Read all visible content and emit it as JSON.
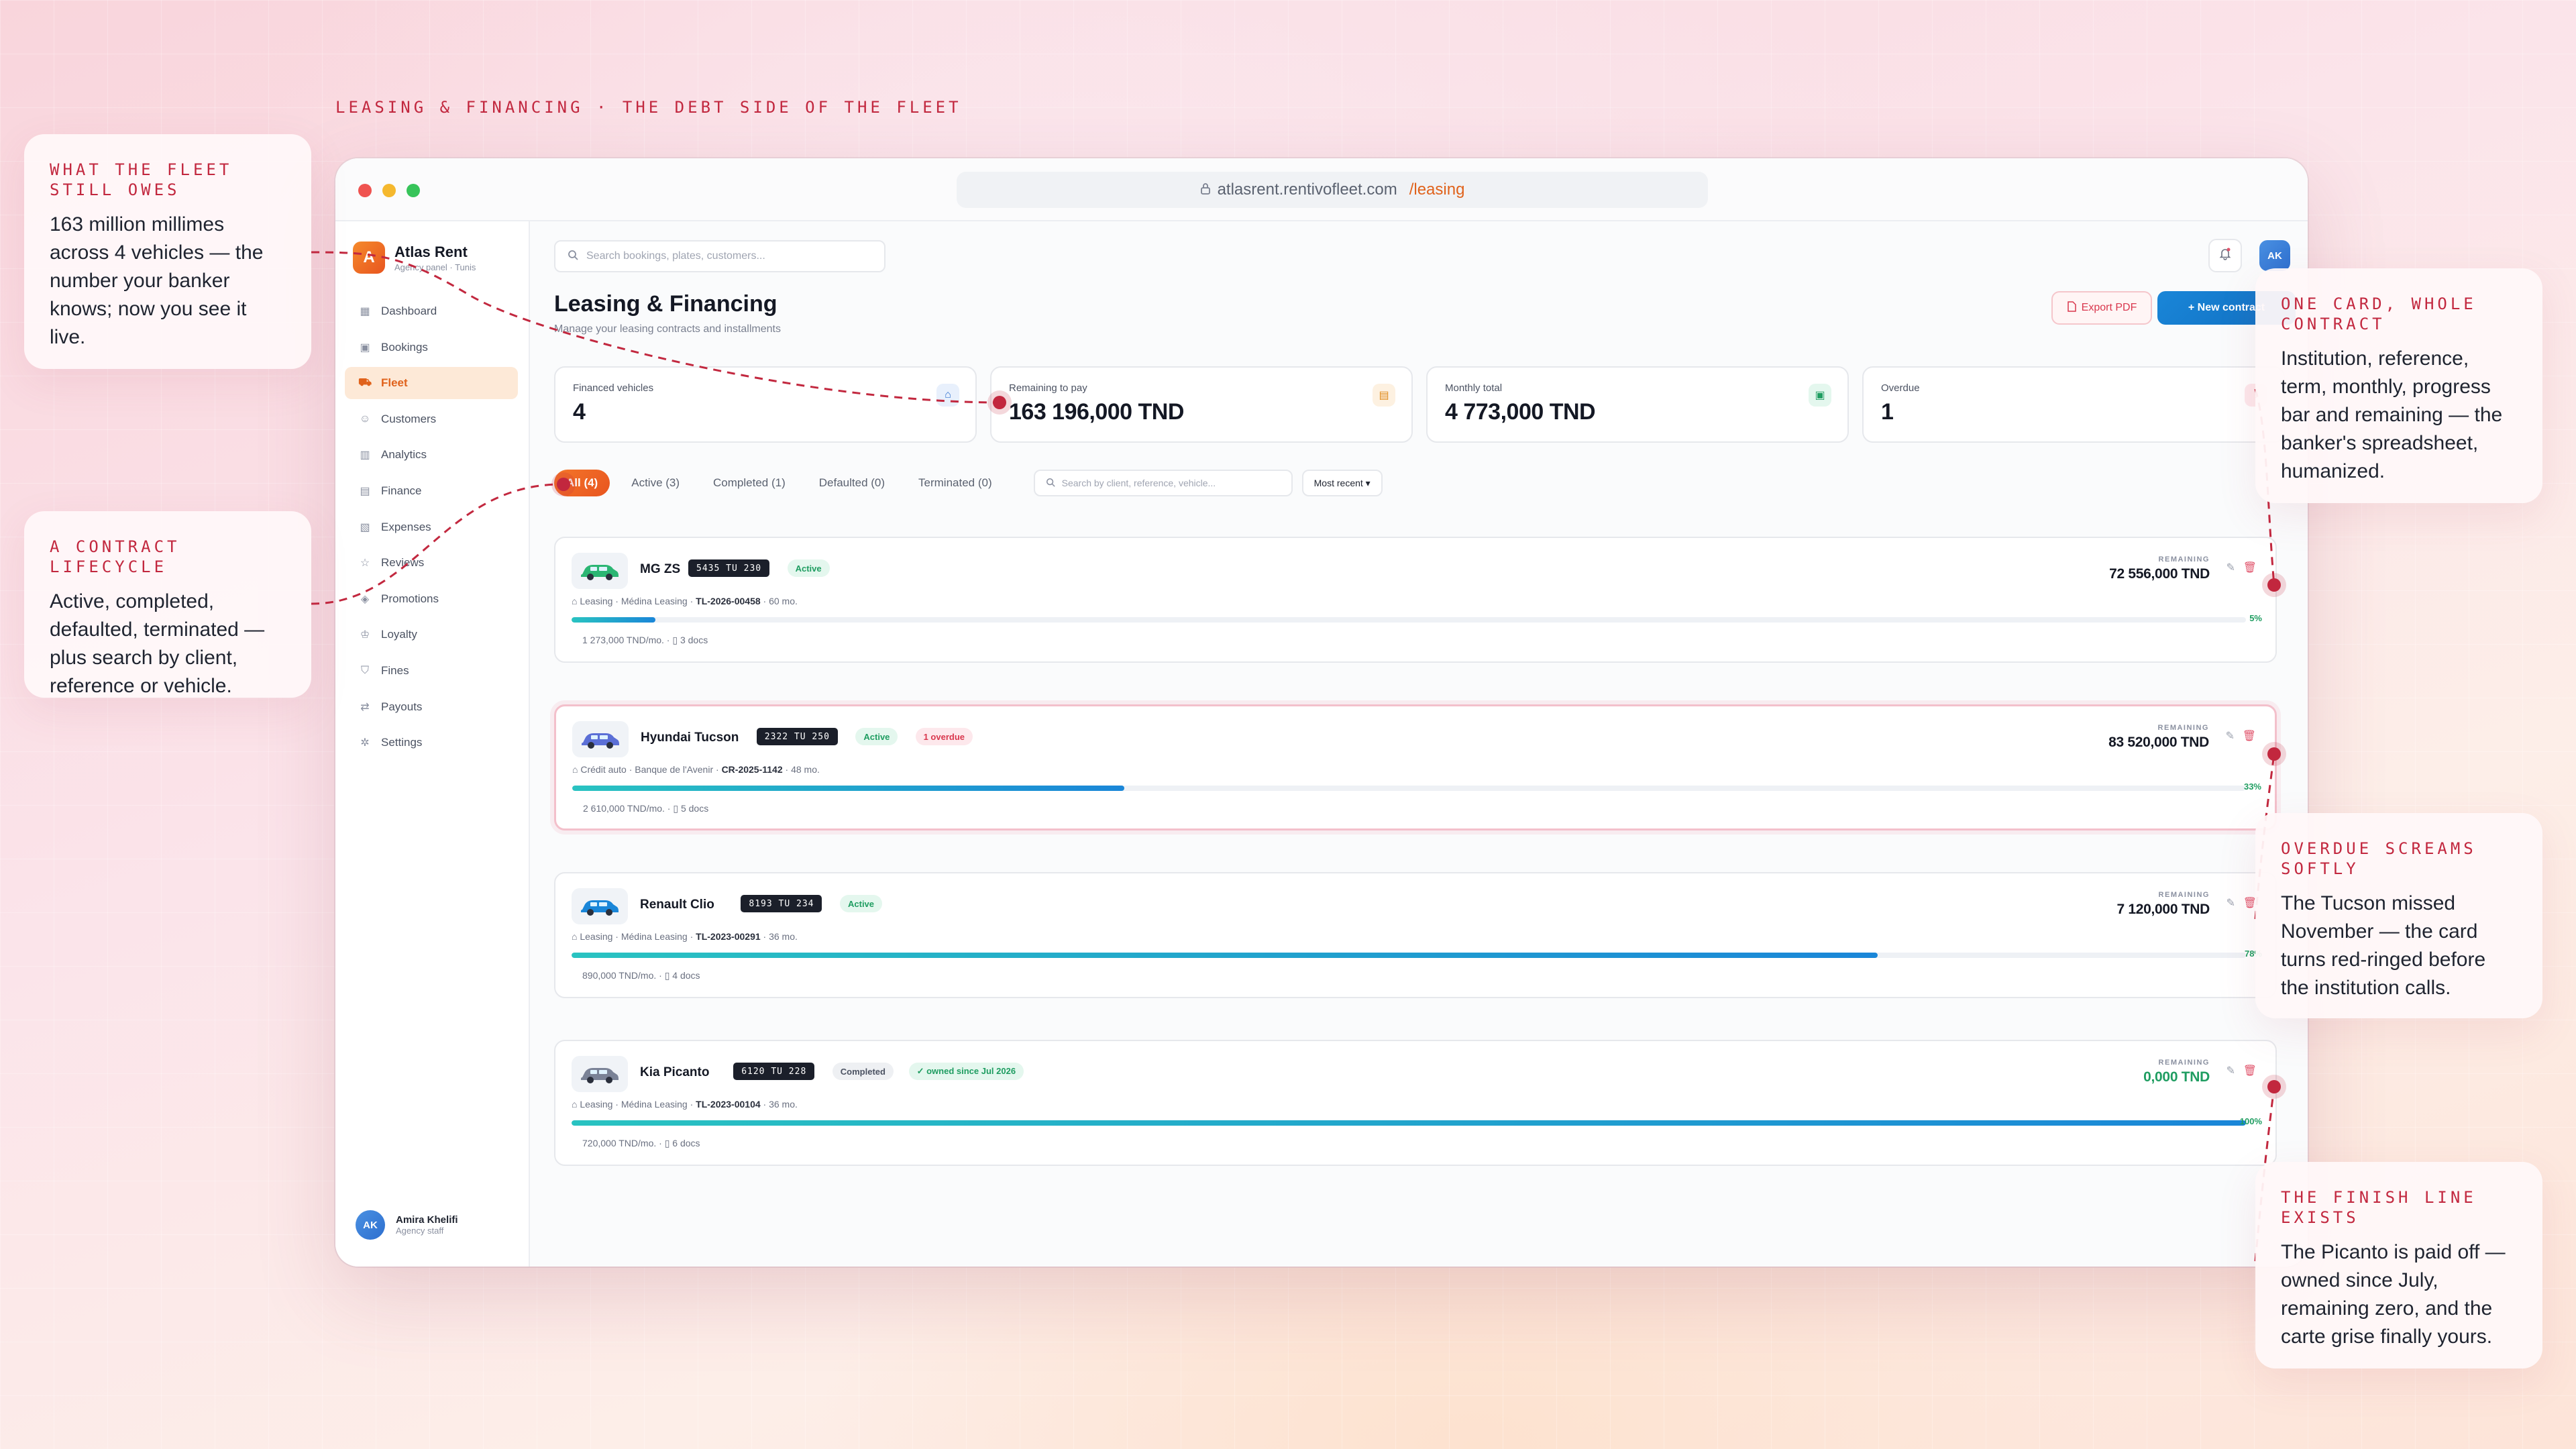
{
  "page_kicker": "LEASING & FINANCING · THE DEBT SIDE OF THE FLEET",
  "callouts": {
    "owed": {
      "kicker": "WHAT THE FLEET STILL OWES",
      "body": "163 million millimes across 4 vehicles — the number your banker knows; now you see it live."
    },
    "lifecycle": {
      "kicker": "A CONTRACT LIFECYCLE",
      "body": "Active, completed, defaulted, terminated — plus search by client, reference or vehicle."
    },
    "card": {
      "kicker": "ONE CARD, WHOLE CONTRACT",
      "body": "Institution, reference, term, monthly, progress bar and remaining — the banker's spreadsheet, humanized."
    },
    "overdue": {
      "kicker": "OVERDUE SCREAMS SOFTLY",
      "body": "The Tucson missed November — the card turns red-ringed before the institution calls."
    },
    "finish": {
      "kicker": "THE FINISH LINE EXISTS",
      "body": "The Picanto is paid off — owned since July, remaining zero, and the carte grise finally yours."
    }
  },
  "browser": {
    "domain": "atlasrent.rentivofleet.com",
    "path": "/leasing"
  },
  "brand": {
    "name": "Atlas Rent",
    "sub": "Agency panel · Tunis",
    "logo_letter": "A"
  },
  "nav": [
    {
      "label": "Dashboard",
      "icon": "grid-icon"
    },
    {
      "label": "Bookings",
      "icon": "calendar-icon"
    },
    {
      "label": "Fleet",
      "icon": "car-icon",
      "active": true
    },
    {
      "label": "Customers",
      "icon": "users-icon"
    },
    {
      "label": "Analytics",
      "icon": "chart-icon"
    },
    {
      "label": "Finance",
      "icon": "wallet-icon"
    },
    {
      "label": "Expenses",
      "icon": "receipt-icon"
    },
    {
      "label": "Reviews",
      "icon": "star-icon"
    },
    {
      "label": "Promotions",
      "icon": "tag-icon"
    },
    {
      "label": "Loyalty",
      "icon": "crown-icon"
    },
    {
      "label": "Fines",
      "icon": "shield-icon"
    },
    {
      "label": "Payouts",
      "icon": "payout-icon"
    },
    {
      "label": "Settings",
      "icon": "gear-icon"
    }
  ],
  "user": {
    "initials": "AK",
    "name": "Amira Khelifi",
    "role": "Agency staff"
  },
  "search": {
    "placeholder": "Search bookings, plates, customers..."
  },
  "header": {
    "title": "Leasing & Financing",
    "subtitle": "Manage your leasing contracts and installments",
    "export_label": "Export PDF",
    "new_label": "+ New contract"
  },
  "stats": [
    {
      "label": "Financed vehicles",
      "value": "4",
      "icon": "bank-icon",
      "color": "#2d6fcf",
      "bg": "#e8f0fc"
    },
    {
      "label": "Remaining to pay",
      "value": "163 196,000 TND",
      "icon": "wallet-icon",
      "color": "#e08a1b",
      "bg": "#fdf1e1"
    },
    {
      "label": "Monthly total",
      "value": "4 773,000 TND",
      "icon": "calendar-icon",
      "color": "#1f9d61",
      "bg": "#e4f7ee"
    },
    {
      "label": "Overdue",
      "value": "1",
      "icon": "alert-icon",
      "color": "#d9374d",
      "bg": "#fde8ec"
    }
  ],
  "filters": {
    "tabs": [
      "All (4)",
      "Active (3)",
      "Completed (1)",
      "Defaulted (0)",
      "Terminated (0)"
    ],
    "search_placeholder": "Search by client, reference, vehicle...",
    "sort": "Most recent ▾"
  },
  "contracts": [
    {
      "name": "MG ZS",
      "plate": "5435 TU 230",
      "status": "Active",
      "overdue": "",
      "owned": "",
      "meta_prefix": "Leasing · Médina Leasing · ",
      "ref": "TL-2026-00458",
      "term": " · 60 mo.",
      "progress": 0.05,
      "pct": "5%",
      "monthly": "1 273,000 TND/mo.",
      "docs": "3 docs",
      "remaining_label": "REMAINING",
      "remaining": "72 556,000 TND",
      "car_color": "#2bb673"
    },
    {
      "name": "Hyundai Tucson",
      "plate": "2322 TU 250",
      "status": "Active",
      "overdue": "1 overdue",
      "owned": "",
      "meta_prefix": "Crédit auto · Banque de l'Avenir · ",
      "ref": "CR-2025-1142",
      "term": " · 48 mo.",
      "progress": 0.33,
      "pct": "33%",
      "monthly": "2 610,000 TND/mo.",
      "docs": "5 docs",
      "remaining_label": "REMAINING",
      "remaining": "83 520,000 TND",
      "car_color": "#5b6fd6"
    },
    {
      "name": "Renault Clio",
      "plate": "8193 TU 234",
      "status": "Active",
      "overdue": "",
      "owned": "",
      "meta_prefix": "Leasing · Médina Leasing · ",
      "ref": "TL-2023-00291",
      "term": " · 36 mo.",
      "progress": 0.78,
      "pct": "78%",
      "monthly": "890,000 TND/mo.",
      "docs": "4 docs",
      "remaining_label": "REMAINING",
      "remaining": "7 120,000 TND",
      "car_color": "#1a86d8"
    },
    {
      "name": "Kia Picanto",
      "plate": "6120 TU 228",
      "status": "Completed",
      "overdue": "",
      "owned": "✓ owned since Jul 2026",
      "meta_prefix": "Leasing · Médina Leasing · ",
      "ref": "TL-2023-00104",
      "term": " · 36 mo.",
      "progress": 1.0,
      "pct": "100%",
      "monthly": "720,000 TND/mo.",
      "docs": "6 docs",
      "remaining_label": "REMAINING",
      "remaining": "0,000 TND",
      "car_color": "#7a8296"
    }
  ]
}
